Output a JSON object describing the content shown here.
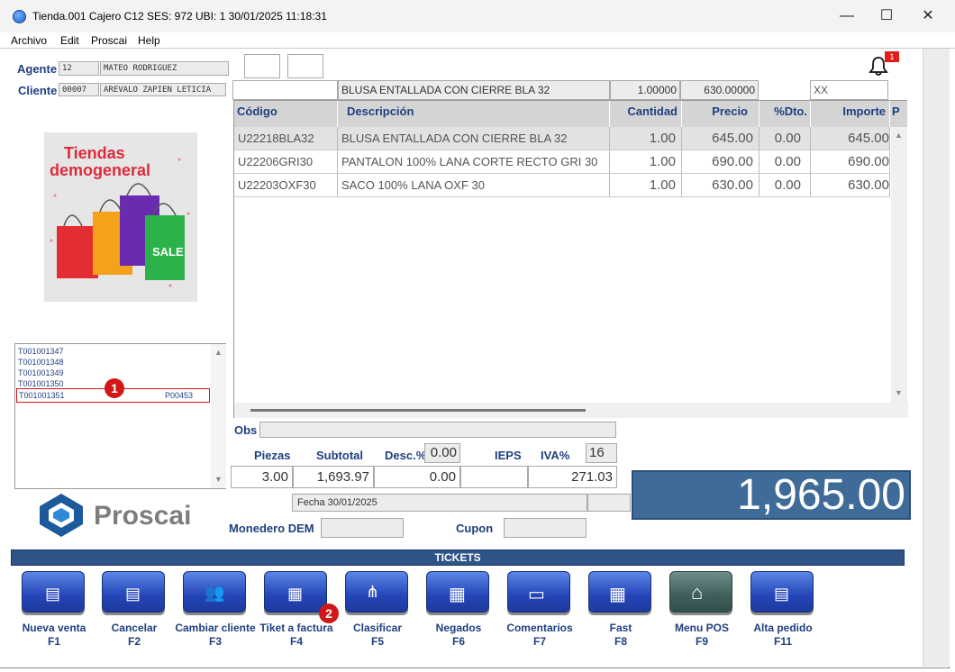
{
  "window": {
    "title": "Tienda.001  Cajero C12    SES: 972   UBI: 1   30/01/2025 11:18:31"
  },
  "menu": [
    "Archivo",
    "Edit",
    "Proscai",
    "Help"
  ],
  "agent": {
    "label": "Agente",
    "code": "12",
    "name": "MATEO RODRIGUEZ"
  },
  "client": {
    "label": "Cliente",
    "code": "00007",
    "name": "AREVALO ZAPIEN LETICIA"
  },
  "banner": {
    "line1": "Tiendas",
    "line2": "demogeneral",
    "sale": "SALE"
  },
  "notification": {
    "count": "1"
  },
  "entry": {
    "description": "BLUSA ENTALLADA CON CIERRE BLA 32",
    "quantity": "1.00000",
    "price": "630.00000",
    "extra": "XX"
  },
  "grid": {
    "headers": [
      "Código",
      "Descripción",
      "Cantidad",
      "Precio",
      "%Dto.",
      "Importe",
      "P"
    ],
    "rows": [
      {
        "code": "U22218BLA32",
        "desc": "BLUSA ENTALLADA CON CIERRE BLA 32",
        "qty": "1.00",
        "price": "645.00",
        "disc": "0.00",
        "amount": "645.00"
      },
      {
        "code": "U22206GRI30",
        "desc": "PANTALON 100% LANA  CORTE RECTO GRI 30",
        "qty": "1.00",
        "price": "690.00",
        "disc": "0.00",
        "amount": "690.00"
      },
      {
        "code": "U22203OXF30",
        "desc": "SACO 100% LANA OXF 30",
        "qty": "1.00",
        "price": "630.00",
        "disc": "0.00",
        "amount": "630.00"
      }
    ]
  },
  "tickets_list": [
    {
      "id": "T001001347",
      "ref": ""
    },
    {
      "id": "T001001348",
      "ref": ""
    },
    {
      "id": "T001001349",
      "ref": ""
    },
    {
      "id": "T001001350",
      "ref": ""
    },
    {
      "id": "T001001351",
      "ref": "P00453"
    }
  ],
  "badges": {
    "one": "1",
    "two": "2"
  },
  "obs": {
    "label": "Obs",
    "value": ""
  },
  "totals": {
    "pieces_label": "Piezas",
    "pieces": "3.00",
    "subtotal_label": "Subtotal",
    "subtotal": "1,693.97",
    "discount_label": "Desc.%",
    "discount_pct": "0.00",
    "discount": "0.00",
    "ieps_label": "IEPS",
    "iva_label": "IVA%",
    "iva_pct": "16",
    "iva": "271.03",
    "total": "1,965.00"
  },
  "fecha": "Fecha 30/01/2025",
  "monedero_label": "Monedero DEM",
  "cupon_label": "Cupon",
  "logo_text": "Proscai",
  "section_title": "TICKETS",
  "toolbar": [
    {
      "label": "Nueva venta",
      "key": "F1",
      "icon": "new-sale-icon"
    },
    {
      "label": "Cancelar",
      "key": "F2",
      "icon": "cancel-icon"
    },
    {
      "label": "Cambiar cliente",
      "key": "F3",
      "icon": "change-client-icon"
    },
    {
      "label": "Tiket a factura",
      "key": "F4",
      "icon": "ticket-invoice-icon"
    },
    {
      "label": "Clasificar",
      "key": "F5",
      "icon": "classify-icon"
    },
    {
      "label": "Negados",
      "key": "F6",
      "icon": "denied-icon"
    },
    {
      "label": "Comentarios",
      "key": "F7",
      "icon": "comments-icon"
    },
    {
      "label": "Fast",
      "key": "F8",
      "icon": "fast-icon"
    },
    {
      "label": "Menu POS",
      "key": "F9",
      "icon": "home-icon"
    },
    {
      "label": "Alta pedido",
      "key": "F11",
      "icon": "new-order-icon"
    }
  ]
}
